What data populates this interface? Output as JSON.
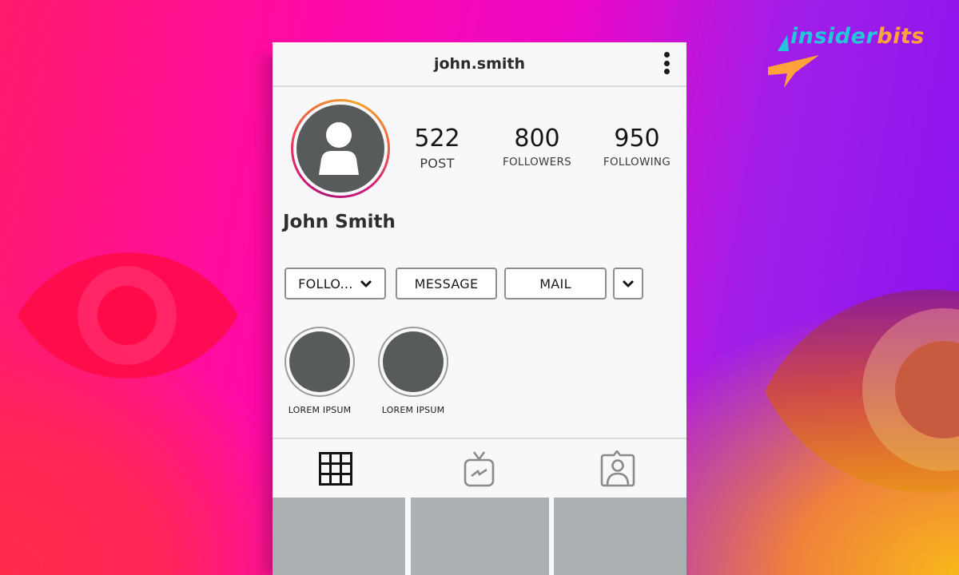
{
  "brand": {
    "logo_part1": "insider",
    "logo_part2": "bits",
    "colors": {
      "teal": "#26c6da",
      "orange": "#ffa23a"
    }
  },
  "background": {
    "decorations": [
      "eye-icon",
      "eye-icon"
    ]
  },
  "profile": {
    "username": "john.smith",
    "menu_icon": "more-vertical-icon",
    "display_name": "John Smith",
    "avatar_icon": "user-icon",
    "stats": [
      {
        "value": "522",
        "label": "POST"
      },
      {
        "value": "800",
        "label": "FOLLOWERS"
      },
      {
        "value": "950",
        "label": "FOLLOWING"
      }
    ],
    "buttons": {
      "following": "FOLLO...",
      "message": "MESSAGE",
      "mail": "MAIL"
    },
    "highlights": [
      {
        "label": "LOREM IPSUM"
      },
      {
        "label": "LOREM IPSUM"
      }
    ],
    "tabs": [
      {
        "name": "posts",
        "icon": "grid-icon",
        "active": true
      },
      {
        "name": "igtv",
        "icon": "tv-icon",
        "active": false
      },
      {
        "name": "tagged",
        "icon": "tagged-person-icon",
        "active": false
      }
    ]
  }
}
